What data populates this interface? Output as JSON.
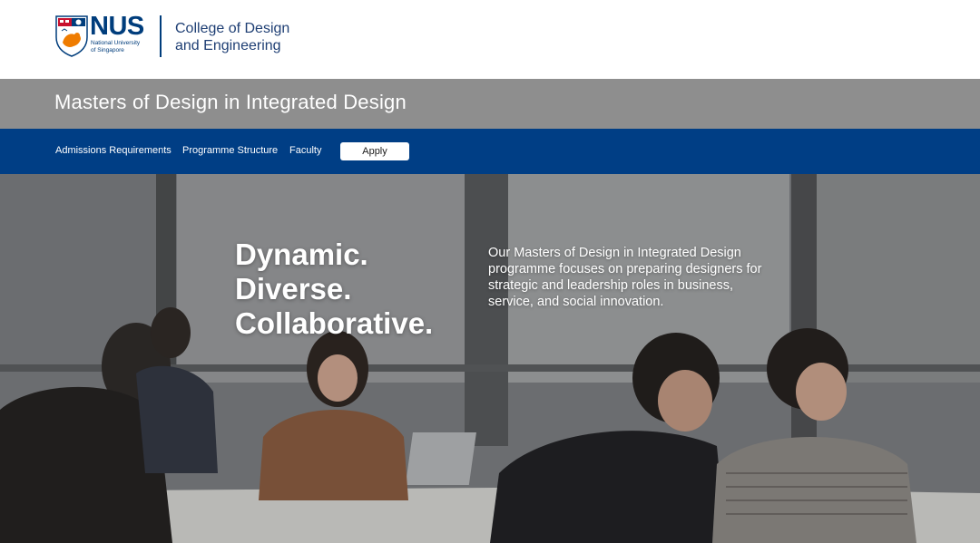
{
  "header": {
    "logo_text": "NUS",
    "logo_subtitle_line1": "National University",
    "logo_subtitle_line2": "of Singapore",
    "college_line1": "College of Design",
    "college_line2": "and Engineering"
  },
  "title_band": {
    "title": "Masters of Design in Integrated Design"
  },
  "nav": {
    "items": [
      {
        "label": "Admissions Requirements"
      },
      {
        "label": "Programme Structure"
      },
      {
        "label": "Faculty"
      }
    ],
    "apply_label": "Apply"
  },
  "hero": {
    "headline_lines": [
      "Dynamic.",
      "Diverse.",
      "Collaborative."
    ],
    "description": "Our Masters of Design in Integrated Design programme focuses on preparing designers for strategic and leadership roles in business, service, and social innovation."
  },
  "colors": {
    "brand_blue": "#003d7c",
    "nav_blue": "#003e85",
    "title_band_gray": "#8e8e8e",
    "nus_orange": "#ef7c00"
  }
}
